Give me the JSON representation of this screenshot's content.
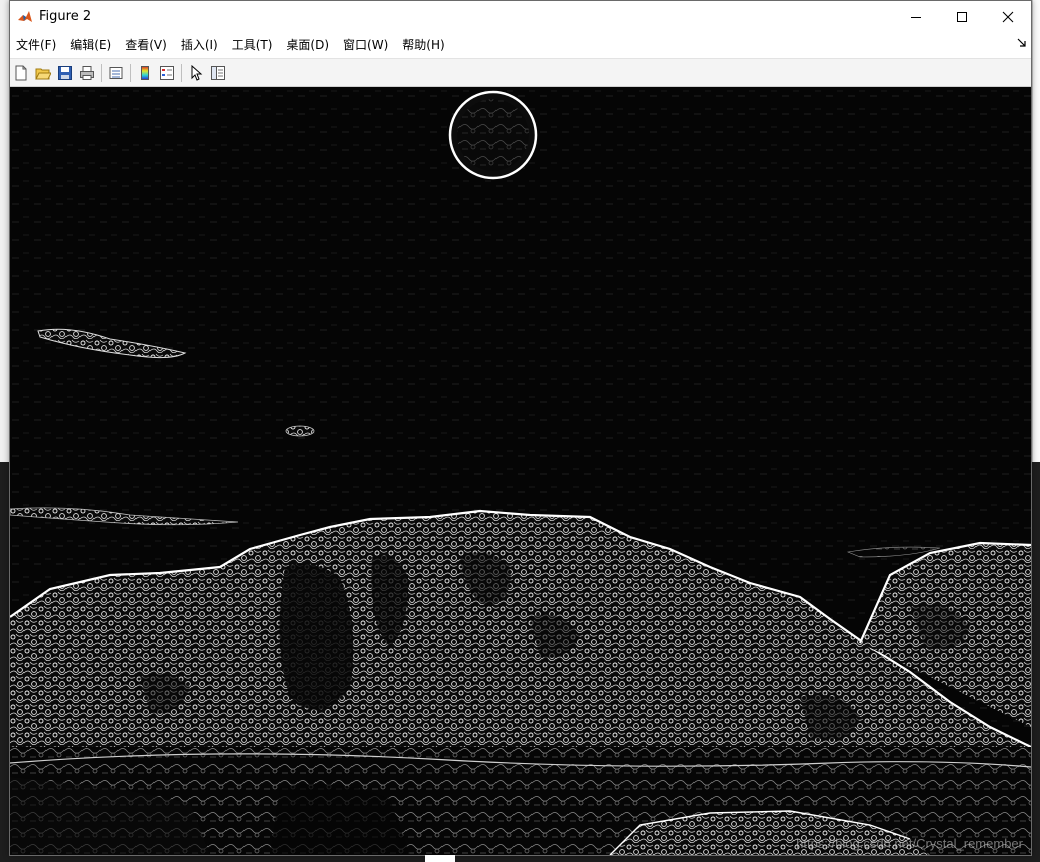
{
  "window": {
    "title": "Figure 2",
    "app_icon": "matlab-icon",
    "controls": [
      "minimize-icon",
      "maximize-icon",
      "close-icon"
    ]
  },
  "menubar": {
    "items": [
      {
        "label": "文件(F)"
      },
      {
        "label": "编辑(E)"
      },
      {
        "label": "查看(V)"
      },
      {
        "label": "插入(I)"
      },
      {
        "label": "工具(T)"
      },
      {
        "label": "桌面(D)"
      },
      {
        "label": "窗口(W)"
      },
      {
        "label": "帮助(H)"
      }
    ]
  },
  "toolbar": {
    "buttons": [
      "new-figure-icon",
      "open-file-icon",
      "save-icon",
      "print-icon",
      "link-plot-icon",
      "colorbar-icon",
      "legend-icon",
      "pointer-icon",
      "property-inspector-icon"
    ]
  },
  "figure": {
    "image_description_tag": "edge-detection-result",
    "watermark": "https://blog.csdn.net/Crystal_remember"
  },
  "colors": {
    "titlebar_bg": "#ffffff",
    "toolbar_bg": "#f4f4f4",
    "axes_bg": "#050505",
    "edge_color": "#ffffff"
  }
}
